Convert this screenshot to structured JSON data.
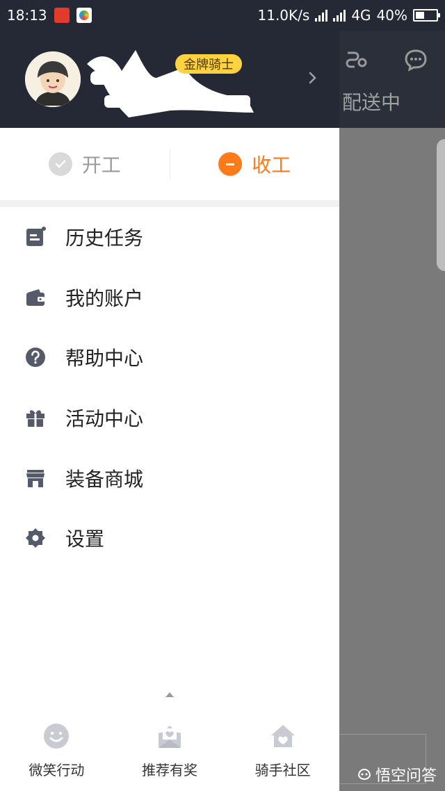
{
  "status_bar": {
    "time": "18:13",
    "speed": "11.0K/s",
    "network": "4G",
    "battery": "40%"
  },
  "background_app": {
    "tab_label": "配送中"
  },
  "profile": {
    "badge": "金牌骑士"
  },
  "work_toggle": {
    "start_label": "开工",
    "stop_label": "收工"
  },
  "menu": {
    "items": [
      {
        "label": "历史任务",
        "icon": "task-history-icon"
      },
      {
        "label": "我的账户",
        "icon": "wallet-icon"
      },
      {
        "label": "帮助中心",
        "icon": "help-icon"
      },
      {
        "label": "活动中心",
        "icon": "gift-icon"
      },
      {
        "label": "装备商城",
        "icon": "store-icon"
      },
      {
        "label": "设置",
        "icon": "settings-icon"
      }
    ]
  },
  "bottom_bar": {
    "items": [
      {
        "label": "微笑行动",
        "icon": "smile-icon"
      },
      {
        "label": "推荐有奖",
        "icon": "referral-mail-icon"
      },
      {
        "label": "骑手社区",
        "icon": "community-home-icon"
      }
    ]
  },
  "watermark": "悟空问答",
  "colors": {
    "header_bg": "#252935",
    "accent": "#ff7a1a",
    "badge": "#ffd23f",
    "icon": "#555a6a"
  }
}
